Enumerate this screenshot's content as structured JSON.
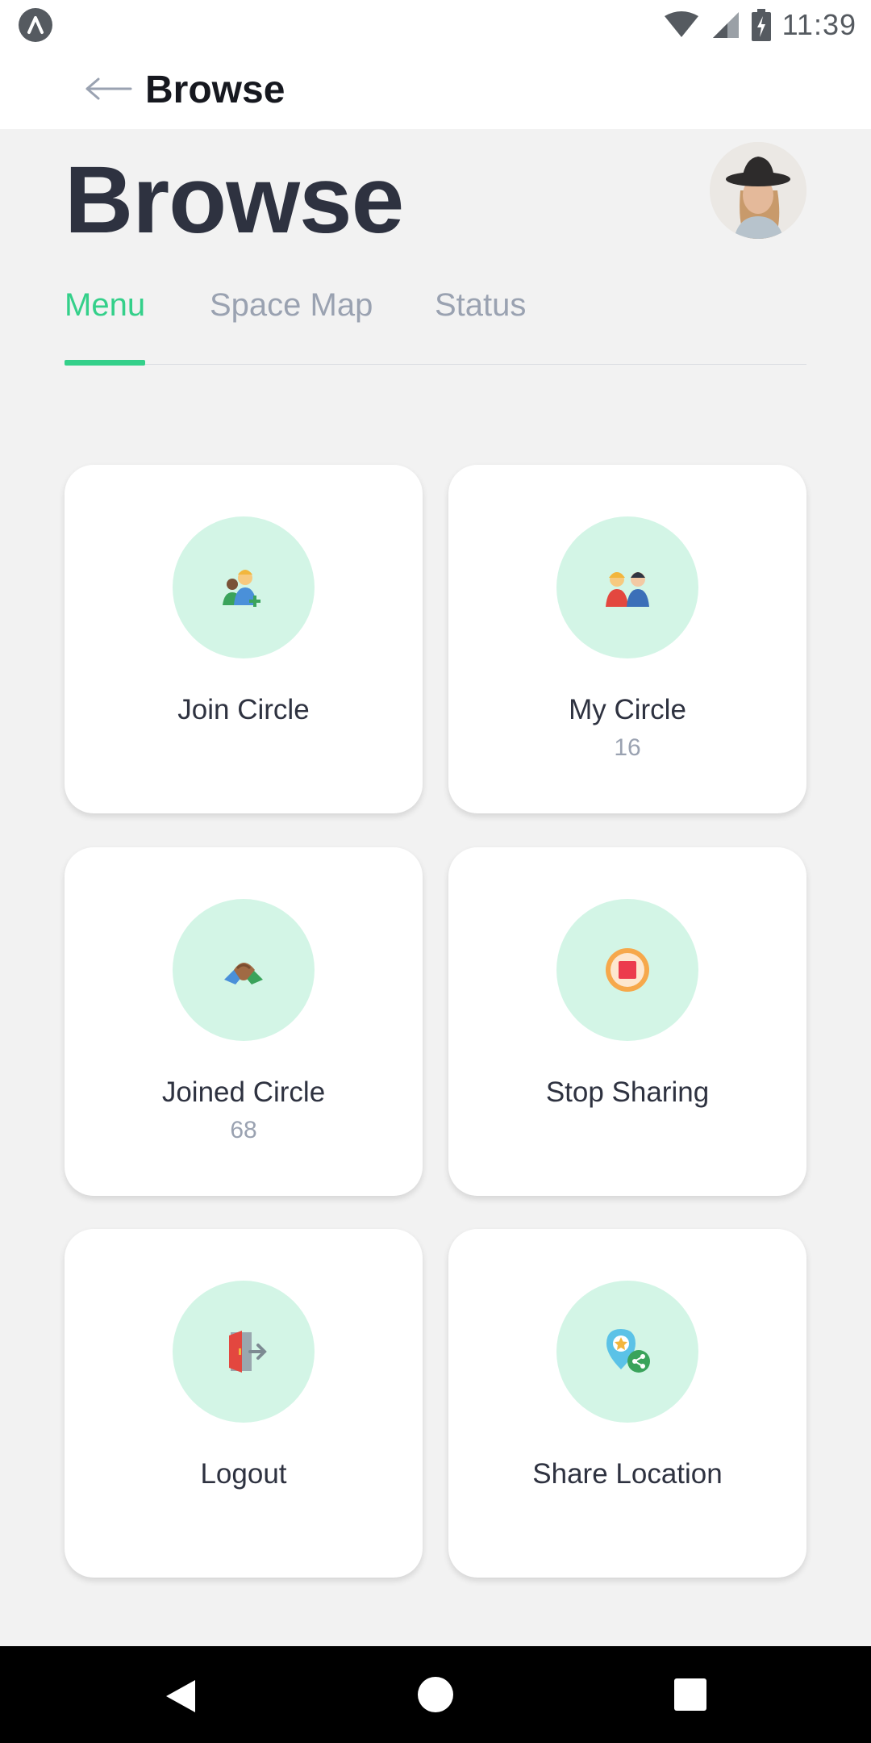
{
  "status_bar": {
    "time": "11:39",
    "icons": [
      "app-icon",
      "wifi-icon",
      "signal-icon",
      "battery-icon"
    ]
  },
  "app_bar": {
    "title": "Browse",
    "back_icon": "arrow-left-icon"
  },
  "header": {
    "title": "Browse",
    "avatar": "user-avatar"
  },
  "tabs": [
    {
      "label": "Menu",
      "active": true
    },
    {
      "label": "Space Map",
      "active": false
    },
    {
      "label": "Status",
      "active": false
    }
  ],
  "cards": [
    {
      "label": "Join Circle",
      "count": null,
      "icon": "add-people-icon"
    },
    {
      "label": "My Circle",
      "count": "16",
      "icon": "friends-icon"
    },
    {
      "label": "Joined Circle",
      "count": "68",
      "icon": "handshake-icon"
    },
    {
      "label": "Stop Sharing",
      "count": null,
      "icon": "stop-icon"
    },
    {
      "label": "Logout",
      "count": null,
      "icon": "logout-door-icon"
    },
    {
      "label": "Share Location",
      "count": null,
      "icon": "share-location-icon"
    }
  ],
  "colors": {
    "accent": "#34d08a",
    "icon_circle": "#d3f5e6",
    "text_dark": "#2e3240",
    "text_muted": "#9aa2b1"
  },
  "nav_bar": {
    "icons": [
      "nav-back-icon",
      "nav-home-icon",
      "nav-recents-icon"
    ]
  }
}
